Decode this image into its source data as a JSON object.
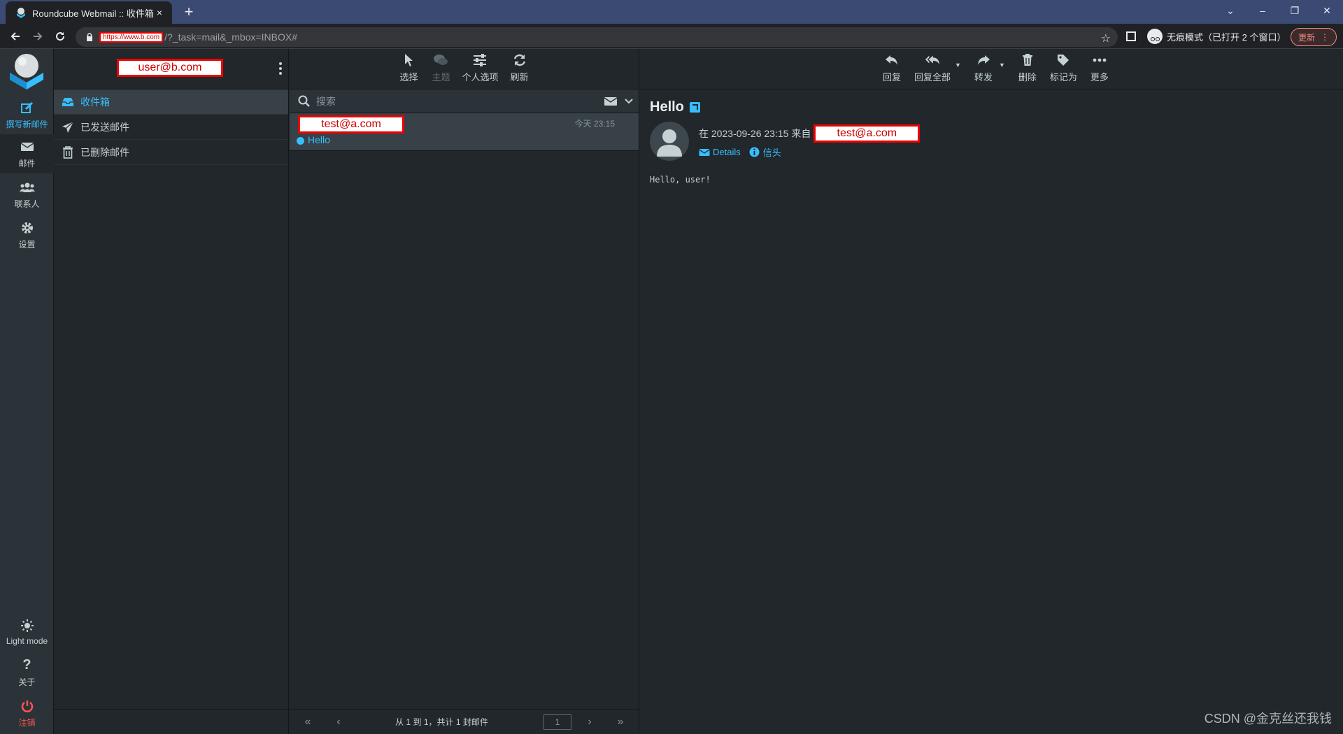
{
  "browser": {
    "tab_title": "Roundcube Webmail :: 收件箱",
    "tab_close": "×",
    "new_tab": "+",
    "url_host": "https://www.b.com",
    "url_rest": "/?_task=mail&_mbox=INBOX#",
    "incognito_label": "无痕模式（已打开 2 个窗口）",
    "update_label": "更新",
    "win_controls": [
      "⌄",
      "–",
      "❐",
      "✕"
    ]
  },
  "taskmenu": {
    "compose": "撰写新邮件",
    "mail": "邮件",
    "contacts": "联系人",
    "settings": "设置",
    "light_mode": "Light mode",
    "about": "关于",
    "logout": "注销"
  },
  "folders": {
    "username": "user@b.com",
    "items": [
      {
        "label": "收件箱",
        "icon": "inbox-icon",
        "selected": true
      },
      {
        "label": "已发送邮件",
        "icon": "paper-plane-icon",
        "selected": false
      },
      {
        "label": "已删除邮件",
        "icon": "trash-icon",
        "selected": false
      }
    ]
  },
  "list_toolbar": {
    "select": "选择",
    "threads": "主题",
    "options": "个人选项",
    "refresh": "刷新"
  },
  "search": {
    "placeholder": "搜索"
  },
  "messages": [
    {
      "from": "test@a.com",
      "date": "今天 23:15",
      "subject": "Hello",
      "unread": true
    }
  ],
  "list_footer": {
    "count_text": "从 1 到 1，共计 1 封邮件",
    "page": "1"
  },
  "content_toolbar": {
    "reply": "回复",
    "reply_all": "回复全部",
    "forward": "转发",
    "delete": "删除",
    "mark": "标记为",
    "more": "更多"
  },
  "message": {
    "subject": "Hello",
    "date_prefix": "在 2023-09-26 23:15 来自",
    "from": "test@a.com",
    "details": "Details",
    "headers": "信头",
    "body": "Hello, user!"
  },
  "watermark": "CSDN @金克丝还我钱",
  "colors": {
    "accent": "#37beff",
    "background": "#21272b",
    "logout": "#ff5552",
    "redact_border": "#ee0000"
  }
}
